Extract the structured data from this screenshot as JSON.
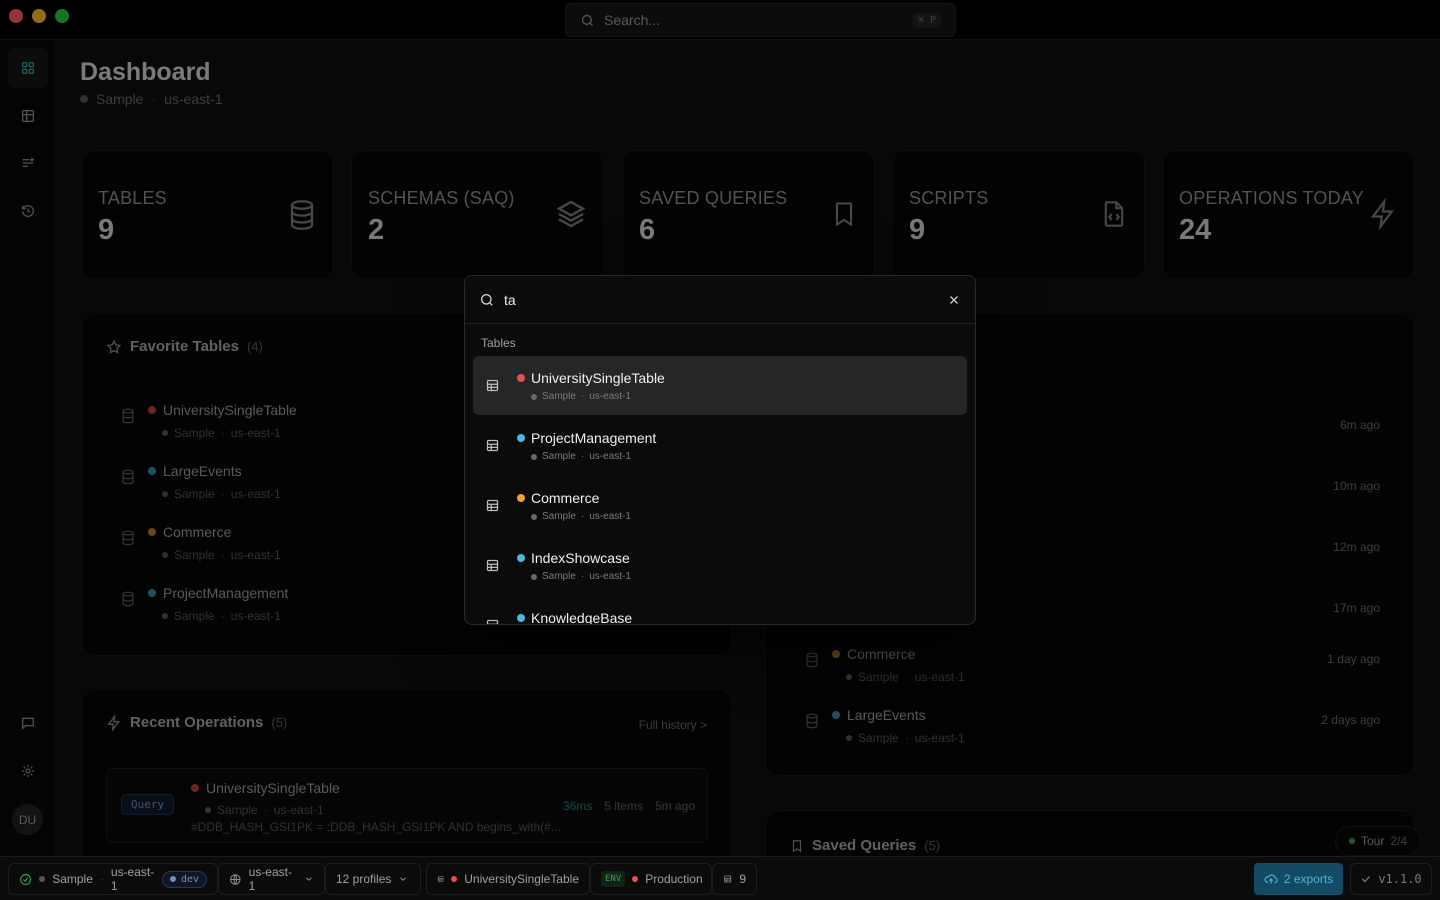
{
  "search": {
    "placeholder": "Search...",
    "shortcut": "⌘ P"
  },
  "header": {
    "title": "Dashboard",
    "connection": "Sample",
    "region": "us-east-1"
  },
  "stats": [
    {
      "label": "TABLES",
      "value": "9",
      "icon": "database-icon"
    },
    {
      "label": "SCHEMAS (SAQ)",
      "value": "2",
      "icon": "layers-icon"
    },
    {
      "label": "SAVED QUERIES",
      "value": "6",
      "icon": "bookmark-icon"
    },
    {
      "label": "SCRIPTS",
      "value": "9",
      "icon": "file-code-icon"
    },
    {
      "label": "OPERATIONS TODAY",
      "value": "24",
      "icon": "lightning-icon"
    }
  ],
  "favorites": {
    "title": "Favorite Tables",
    "count": "(4)",
    "items": [
      {
        "name": "UniversitySingleTable",
        "connection": "Sample",
        "region": "us-east-1",
        "color": "#b8443a"
      },
      {
        "name": "LargeEvents",
        "connection": "Sample",
        "region": "us-east-1",
        "color": "#3a8ab0"
      },
      {
        "name": "Commerce",
        "connection": "Sample",
        "region": "us-east-1",
        "color": "#b8792a"
      },
      {
        "name": "ProjectManagement",
        "connection": "Sample",
        "region": "us-east-1",
        "color": "#3a8ab0"
      }
    ]
  },
  "recent_tables": {
    "items": [
      {
        "time": "6m ago"
      },
      {
        "time": "10m ago"
      },
      {
        "time": "12m ago"
      },
      {
        "time": "17m ago"
      },
      {
        "name": "Commerce",
        "connection": "Sample",
        "region": "us-east-1",
        "color": "#b8792a",
        "time": "1 day ago"
      },
      {
        "name": "LargeEvents",
        "connection": "Sample",
        "region": "us-east-1",
        "color": "#3a8ab0",
        "time": "2 days ago"
      }
    ]
  },
  "recent_ops": {
    "title": "Recent Operations",
    "count": "(5)",
    "full_history": "Full history >",
    "item": {
      "type": "Query",
      "table": "UniversitySingleTable",
      "connection": "Sample",
      "region": "us-east-1",
      "expression": "#DDB_HASH_GSI1PK = :DDB_HASH_GSI1PK AND begins_with(#...",
      "duration": "36ms",
      "items": "5 items",
      "time": "5m ago",
      "color": "#b8443a"
    }
  },
  "saved_queries": {
    "title": "Saved Queries",
    "count": "(5)"
  },
  "tour": {
    "label": "Tour",
    "step": "2/4"
  },
  "palette": {
    "query": "ta",
    "group": "Tables",
    "items": [
      {
        "name": "UniversitySingleTable",
        "connection": "Sample",
        "region": "us-east-1",
        "color": "#e5534b"
      },
      {
        "name": "ProjectManagement",
        "connection": "Sample",
        "region": "us-east-1",
        "color": "#4fb6e0"
      },
      {
        "name": "Commerce",
        "connection": "Sample",
        "region": "us-east-1",
        "color": "#f0a23a"
      },
      {
        "name": "IndexShowcase",
        "connection": "Sample",
        "region": "us-east-1",
        "color": "#4fb6e0"
      },
      {
        "name": "KnowledgeBase",
        "color": "#4fb6e0"
      }
    ]
  },
  "statusbar": {
    "connection": "Sample",
    "region": "us-east-1",
    "env_badge": "dev",
    "region_select": "us-east-1",
    "profiles": "12 profiles",
    "table": "UniversitySingleTable",
    "env_tag": "ENV",
    "environment": "Production",
    "table_count": "9",
    "exports": "2 exports",
    "version": "v1.1.0"
  },
  "colors": {
    "accent": "#4fb3d9",
    "dev": "#6f8ec2",
    "success": "#3f9c54"
  }
}
